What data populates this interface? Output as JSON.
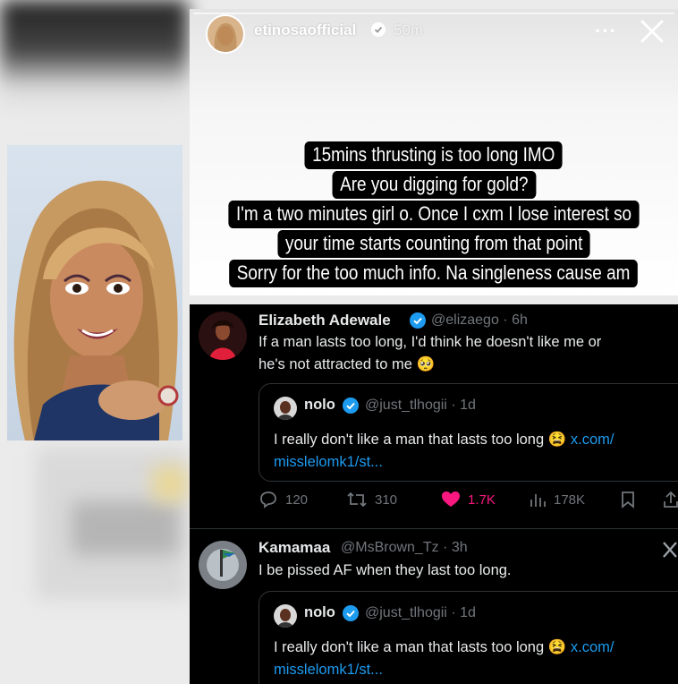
{
  "story": {
    "username": "etinosaofficial",
    "time": "50m",
    "more_icon": "more-horizontal-icon",
    "close_icon": "close-icon",
    "caption_lines": [
      "15mins thrusting is too long IMO",
      "Are you digging for gold?",
      "I'm a two minutes girl o. Once I cxm I lose interest so",
      "your time starts counting from that point",
      "Sorry for the too much info. Na singleness cause am"
    ]
  },
  "tweet1": {
    "name": "Elizabeth Adewale",
    "handle": "@elizaego · 6h",
    "text_line1": "If a man lasts too long, I'd think he doesn't like me or",
    "text_line2": "he's not attracted to me 🥺",
    "quote": {
      "name": "nolo",
      "handle": "@just_tlhogii · 1d",
      "text_line1": "I really don't like a man that lasts too long 😫 ",
      "link1": "x.com/",
      "link2": "misslelomk1/st..."
    },
    "actions": {
      "replies": "120",
      "reposts": "310",
      "likes": "1.7K",
      "views": "178K"
    }
  },
  "tweet2": {
    "name": "Kamamaa",
    "handle": "@MsBrown_Tz · 3h",
    "text": "I be pissed AF when they last too long.",
    "quote": {
      "name": "nolo",
      "handle": "@just_tlhogii · 1d",
      "text_line1": "I really don't like a man that lasts too long 😫 ",
      "link1": "x.com/",
      "link2": "misslelomk1/st..."
    }
  },
  "colors": {
    "twitter_blue": "#1d9bf0",
    "like_pink": "#f91880",
    "muted": "#71767b"
  }
}
